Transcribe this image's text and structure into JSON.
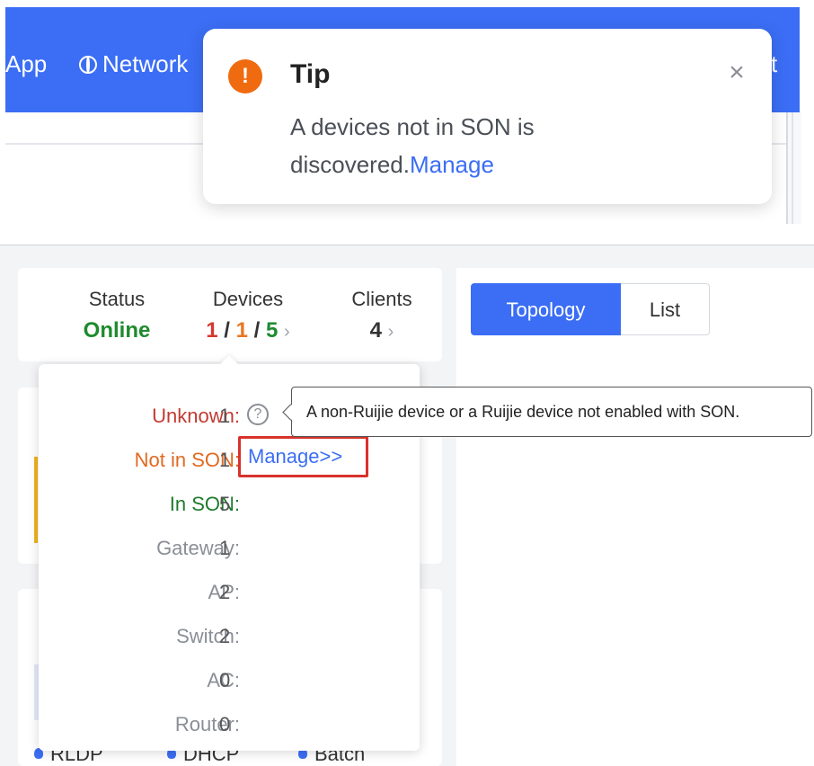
{
  "nav": {
    "app_label": "App",
    "network_label": "Network",
    "right_partial_label": "t"
  },
  "tip": {
    "title": "Tip",
    "message": "A devices not in SON is discovered.",
    "link_label": "Manage",
    "close_glyph": "×",
    "icon_glyph": "!"
  },
  "summary": {
    "status_label": "Status",
    "status_value": "Online",
    "devices_label": "Devices",
    "devices_unknown": "1",
    "devices_not_in_son": "1",
    "devices_in_son": "5",
    "separator": "/",
    "clients_label": "Clients",
    "clients_value": "4",
    "chevron": "›"
  },
  "view_toggle": {
    "topology_label": "Topology",
    "list_label": "List"
  },
  "device_popover": {
    "unknown_label": "Unknown:",
    "unknown_value": "1",
    "not_in_son_label": "Not in SON:",
    "not_in_son_value": "1",
    "manage_label": "Manage>>",
    "in_son_label": "In SON:",
    "in_son_value": "5",
    "gateway_label": "Gateway:",
    "gateway_value": "1",
    "ap_label": "AP:",
    "ap_value": "2",
    "switch_label": "Switch:",
    "switch_value": "2",
    "ac_label": "AC:",
    "ac_value": "0",
    "router_label": "Router:",
    "router_value": "0",
    "help_glyph": "?"
  },
  "tooltip": {
    "text": "A non-Ruijie device or a Ruijie device not enabled with SON."
  },
  "bottom_tabs": {
    "rldp_label": "RLDP",
    "dhcp_label": "DHCP",
    "batch_label": "Batch"
  },
  "colors": {
    "accent": "#3b6ef5",
    "online_green": "#1f8a2e",
    "unknown_red": "#c23a32",
    "not_in_son_orange": "#e06a23",
    "warning_orange": "#f06a0f",
    "highlight_red": "#d7322b"
  },
  "icons": {
    "network": "network-globe-icon",
    "tip": "warning-icon",
    "close": "close-icon",
    "help": "question-circle-icon"
  }
}
